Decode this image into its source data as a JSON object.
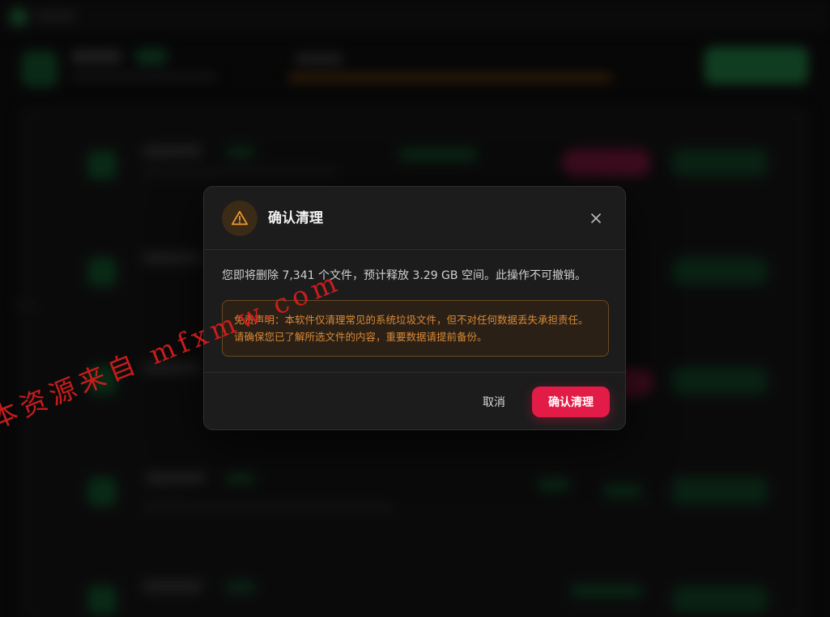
{
  "dialog": {
    "title": "确认清理",
    "message": "您即将删除 7,341 个文件，预计释放 3.29 GB 空间。此操作不可撤销。",
    "disclaimer": "免责声明：本软件仅清理常见的系统垃圾文件，但不对任何数据丢失承担责任。请确保您已了解所选文件的内容，重要数据请提前备份。",
    "cancel_label": "取消",
    "confirm_label": "确认清理",
    "icons": {
      "warning": "warning-icon",
      "close": "close-icon"
    },
    "colors": {
      "confirm": "#e31b47",
      "warning": "#e8952d",
      "disclaimer_text": "#d98a3a"
    }
  },
  "watermark": {
    "text": "本资源来自 mfxmw.com"
  }
}
